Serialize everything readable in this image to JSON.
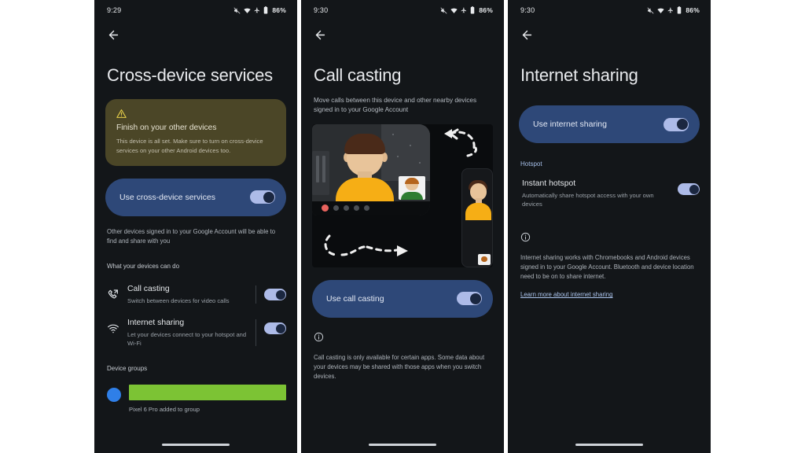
{
  "meta": {
    "background": "#ffffff",
    "phone_bg": "#131619",
    "accent_blue": "#2e4878",
    "switch_track": "#adbbe8",
    "switch_knob": "#1b2740",
    "warn_card_bg": "#4b4627",
    "redaction_green": "#7cc334",
    "device_dot_blue": "#2f7fe8"
  },
  "phones": [
    {
      "status": {
        "time": "9:29",
        "battery": "86%",
        "icons": [
          "mute-icon",
          "wifi-icon",
          "airplane-icon",
          "battery-icon"
        ]
      },
      "back_label": "Back",
      "title": "Cross-device services",
      "warning": {
        "icon": "warning-triangle-icon",
        "title": "Finish on your other devices",
        "body": "This device is all set. Make sure to turn on cross-device services on your other Android devices too."
      },
      "main_toggle": {
        "label": "Use cross-device services",
        "on": true
      },
      "help_text": "Other devices signed in to your Google Account will be able to find and share with you",
      "section_head": "What your devices can do",
      "rows": [
        {
          "icon": "phone-cast-icon",
          "title": "Call casting",
          "subtitle": "Switch between devices for video calls",
          "on": true
        },
        {
          "icon": "wifi-icon",
          "title": "Internet sharing",
          "subtitle": "Let your devices connect to your hotspot and Wi-Fi",
          "on": true
        }
      ],
      "device_groups_head": "Device groups",
      "device_group": {
        "redacted": true,
        "caption": "Pixel 6 Pro added to group"
      }
    },
    {
      "status": {
        "time": "9:30",
        "battery": "86%",
        "icons": [
          "mute-icon",
          "wifi-icon",
          "airplane-icon",
          "battery-icon"
        ]
      },
      "back_label": "Back",
      "title": "Call casting",
      "subtitle": "Move calls between this device and other nearby devices signed in to your Google Account",
      "illustration": "call-casting-illustration",
      "main_toggle": {
        "label": "Use call casting",
        "on": true
      },
      "info_icon": "info-circle-icon",
      "footnote": "Call casting is only available for certain apps. Some data about your devices may be shared with those apps when you switch devices."
    },
    {
      "status": {
        "time": "9:30",
        "battery": "86%",
        "icons": [
          "mute-icon",
          "wifi-icon",
          "airplane-icon",
          "battery-icon"
        ]
      },
      "back_label": "Back",
      "title": "Internet sharing",
      "main_toggle": {
        "label": "Use internet sharing",
        "on": true
      },
      "section_head": "Hotspot",
      "rows": [
        {
          "title": "Instant hotspot",
          "subtitle": "Automatically share hotspot access with your own devices",
          "on": true
        }
      ],
      "info_icon": "info-circle-icon",
      "footnote": "Internet sharing works with Chromebooks and Android devices signed in to your Google Account. Bluetooth and device location need to be on to share internet.",
      "link": "Learn more about internet sharing"
    }
  ]
}
